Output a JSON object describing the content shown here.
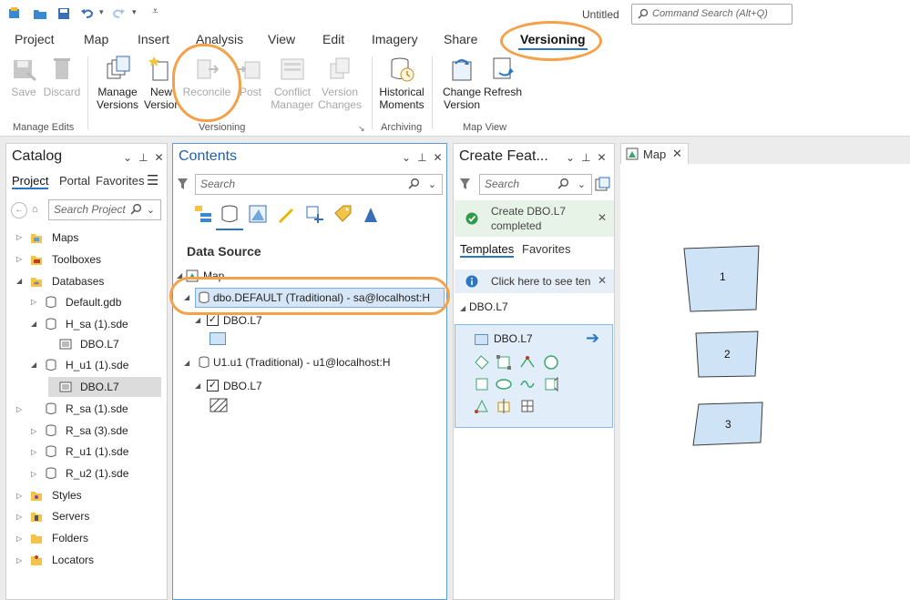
{
  "window": {
    "title": "Untitled",
    "command_search_placeholder": "Command Search (Alt+Q)"
  },
  "tabs": [
    "Project",
    "Map",
    "Insert",
    "Analysis",
    "View",
    "Edit",
    "Imagery",
    "Share",
    "Versioning"
  ],
  "active_tab": "Versioning",
  "ribbon": {
    "groups": [
      {
        "label": "Manage Edits",
        "buttons": [
          "Save",
          "Discard"
        ]
      },
      {
        "label": "Versioning",
        "buttons": [
          "Manage\nVersions",
          "New\nVersion",
          "Reconcile",
          "Post",
          "Conflict\nManager",
          "Version\nChanges"
        ]
      },
      {
        "label": "Archiving",
        "buttons": [
          "Historical\nMoments"
        ]
      },
      {
        "label": "Map View",
        "buttons": [
          "Change\nVersion",
          "Refresh"
        ]
      }
    ],
    "labels": {
      "save": "Save",
      "discard": "Discard",
      "manage_versions_1": "Manage",
      "manage_versions_2": "Versions",
      "new_version_1": "New",
      "new_version_2": "Version",
      "reconcile": "Reconcile",
      "post": "Post",
      "conflict_1": "Conflict",
      "conflict_2": "Manager",
      "version_changes_1": "Version",
      "version_changes_2": "Changes",
      "historical_1": "Historical",
      "historical_2": "Moments",
      "change_version_1": "Change",
      "change_version_2": "Version",
      "refresh": "Refresh",
      "grp_manage_edits": "Manage Edits",
      "grp_versioning": "Versioning",
      "grp_archiving": "Archiving",
      "grp_map_view": "Map View"
    }
  },
  "catalog": {
    "title": "Catalog",
    "tabs": [
      "Project",
      "Portal",
      "Favorites"
    ],
    "search_placeholder": "Search Project",
    "items": [
      "Maps",
      "Toolboxes",
      "Databases",
      "Default.gdb",
      "H_sa (1).sde",
      "DBO.L7",
      "H_u1 (1).sde",
      "DBO.L7",
      "R_sa (1).sde",
      "R_sa (3).sde",
      "R_u1 (1).sde",
      "R_u2 (1).sde",
      "Styles",
      "Servers",
      "Folders",
      "Locators"
    ]
  },
  "contents": {
    "title": "Contents",
    "search_placeholder": "Search",
    "section": "Data Source",
    "map": "Map",
    "ws1": "dbo.DEFAULT (Traditional) - sa@localhost:H",
    "ws1_layer": "DBO.L7",
    "ws2": "U1.u1 (Traditional) - u1@localhost:H",
    "ws2_layer": "DBO.L7"
  },
  "create_features": {
    "title": "Create Feat...",
    "search_placeholder": "Search",
    "notice": "Create DBO.L7 completed",
    "notice_l1": "Create DBO.L7",
    "notice_l2": "completed",
    "tabs": [
      "Templates",
      "Favorites"
    ],
    "hint": "Click here to see ten",
    "group": "DBO.L7",
    "template": "DBO.L7"
  },
  "map_tab": {
    "title": "Map",
    "features": [
      "1",
      "2",
      "3"
    ]
  },
  "colors": {
    "accent": "#2a76c6",
    "annotation": "#f4a14a",
    "polygon_fill": "#cfe3f7",
    "selected_bg": "#d6e6f7"
  }
}
